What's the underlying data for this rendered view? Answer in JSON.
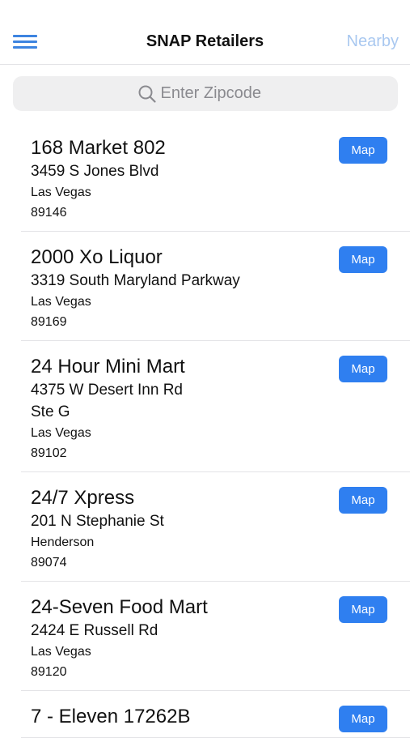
{
  "navbar": {
    "title": "SNAP Retailers",
    "nearby_label": "Nearby",
    "menu_icon": "hamburger-menu-icon"
  },
  "search": {
    "placeholder": "Enter Zipcode",
    "value": "",
    "icon": "search-icon"
  },
  "retailers": [
    {
      "name": "168 Market 802",
      "address": "3459 S Jones Blvd",
      "address2": "",
      "city": "Las Vegas",
      "zip": "89146",
      "map_label": "Map"
    },
    {
      "name": "2000 Xo Liquor",
      "address": "3319 South Maryland Parkway",
      "address2": "",
      "city": "Las Vegas",
      "zip": "89169",
      "map_label": "Map"
    },
    {
      "name": "24 Hour Mini Mart",
      "address": "4375 W Desert Inn Rd",
      "address2": "Ste G",
      "city": "Las Vegas",
      "zip": "89102",
      "map_label": "Map"
    },
    {
      "name": "24/7 Xpress",
      "address": "201 N Stephanie St",
      "address2": "",
      "city": "Henderson",
      "zip": "89074",
      "map_label": "Map"
    },
    {
      "name": "24-Seven Food Mart",
      "address": "2424 E Russell Rd",
      "address2": "",
      "city": "Las Vegas",
      "zip": "89120",
      "map_label": "Map"
    },
    {
      "name": "7 - Eleven 17262B",
      "address": "",
      "address2": "",
      "city": "",
      "zip": "",
      "map_label": "Map"
    }
  ],
  "colors": {
    "accent": "#2f7ff0",
    "nearby_disabled": "#a9c8f0",
    "search_bg": "#efeff0"
  }
}
